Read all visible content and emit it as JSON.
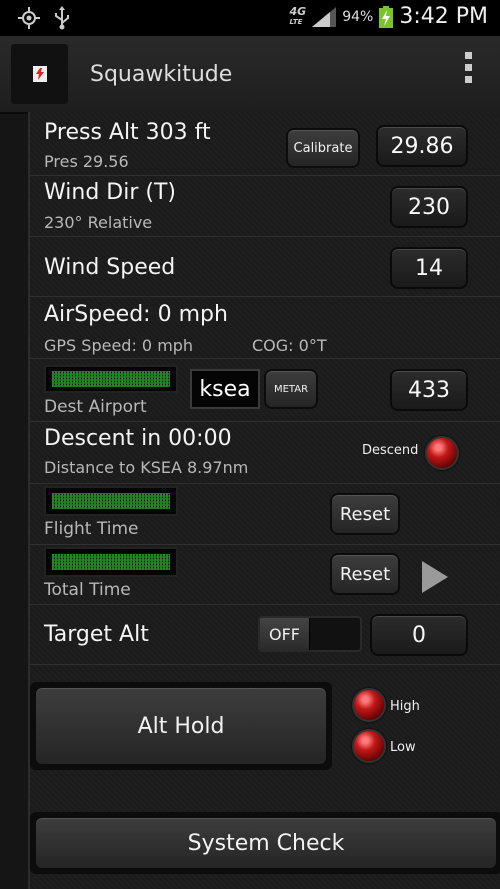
{
  "status_bar": {
    "icons": [
      "gps-icon",
      "usb-icon"
    ],
    "network": "4G",
    "network_sub": "LTE",
    "battery": "94%",
    "time": "3:42 PM"
  },
  "action_bar": {
    "title": "Squawkitude",
    "menu_icon": "overflow-menu-icon"
  },
  "pressure": {
    "title": "Press Alt 303 ft",
    "subtitle": "Pres 29.56",
    "calibrate_label": "Calibrate",
    "value": "29.86"
  },
  "wind_dir": {
    "title": "Wind Dir (T)",
    "subtitle": "230°  Relative",
    "value": "230"
  },
  "wind_speed": {
    "title": "Wind Speed",
    "value": "14"
  },
  "airspeed": {
    "title": "AirSpeed: 0 mph",
    "gps_speed": "GPS Speed: 0 mph",
    "cog": "COG: 0°T"
  },
  "dest_airport": {
    "label": "Dest Airport",
    "code": "ksea",
    "metar_label": "METAR",
    "value": "433"
  },
  "descent": {
    "title": "Descent in 00:00",
    "subtitle": "Distance to KSEA 8.97nm",
    "descend_label": "Descend",
    "descend_color": "#c01818"
  },
  "flight_time": {
    "label": "Flight Time",
    "reset_label": "Reset"
  },
  "total_time": {
    "label": "Total Time",
    "reset_label": "Reset"
  },
  "target_alt": {
    "label": "Target Alt",
    "toggle_state": "OFF",
    "value": "0"
  },
  "alt_hold": {
    "button_label": "Alt Hold",
    "high_label": "High",
    "low_label": "Low"
  },
  "system_check": {
    "button_label": "System Check"
  },
  "colors": {
    "lcd_green": "#2a9a2a",
    "led_red": "#c01818",
    "background": "#151515"
  }
}
